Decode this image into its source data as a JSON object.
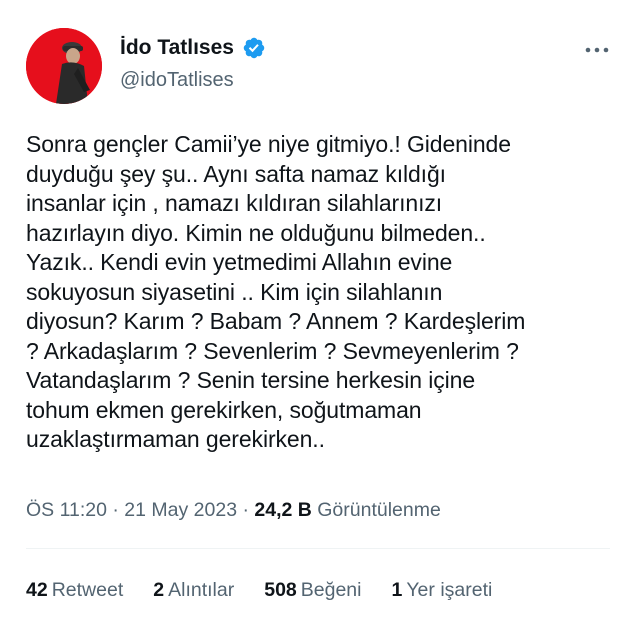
{
  "author": {
    "display_name": "İdo Tatlıses",
    "handle": "@idoTatlises",
    "verified_icon": "verified-badge-icon",
    "avatar_color": "#e60f1c"
  },
  "tweet": {
    "lines": [
      "Sonra gençler Camii’ye niye gitmiyo.! Gideninde",
      "duyduğu şey şu.. Aynı safta namaz kıldığı",
      "insanlar için , namazı kıldıran silahlarınızı",
      "hazırlayın diyo. Kimin ne olduğunu bilmeden..",
      "Yazık.. Kendi evin yetmedimi Allahın evine",
      "sokuyosun siyasetini .. Kim için silahlanın",
      "diyosun?  Karım ? Babam ? Annem ? Kardeşlerim",
      "? Arkadaşlarım ? Sevenlerim ? Sevmeyenlerim ?",
      "Vatandaşlarım ? Senin tersine herkesin içine",
      "tohum ekmen gerekirken, soğutmaman",
      "uzaklaştırmaman gerekirken.."
    ]
  },
  "meta": {
    "time": "ÖS 11:20",
    "date": "21 May 2023",
    "separator": "·",
    "views_count": "24,2 B",
    "views_label": "Görüntülenme"
  },
  "stats": {
    "retweets": {
      "count": "42",
      "label": "Retweet"
    },
    "quotes": {
      "count": "2",
      "label": "Alıntılar"
    },
    "likes": {
      "count": "508",
      "label": "Beğeni"
    },
    "bookmarks": {
      "count": "1",
      "label": "Yer işareti"
    }
  },
  "colors": {
    "accent": "#1d9bf0",
    "text": "#0f1419",
    "secondary": "#536471"
  }
}
